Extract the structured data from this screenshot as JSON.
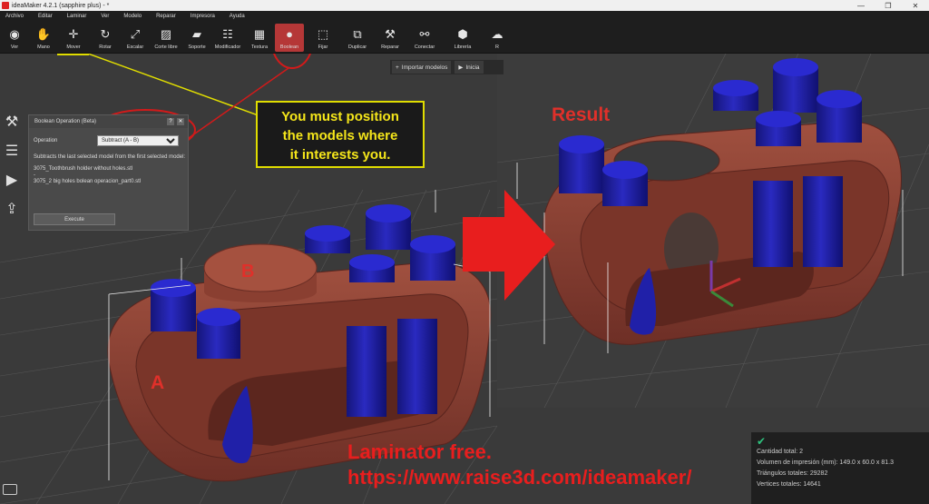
{
  "window": {
    "title": "ideaMaker 4.2.1 (sapphire plus) - *",
    "controls": [
      "—",
      "❐",
      "✕"
    ]
  },
  "menu": [
    "Archivo",
    "Editar",
    "Laminar",
    "Ver",
    "Modelo",
    "Reparar",
    "Impresora",
    "Ayuda"
  ],
  "toolbar": {
    "tools": [
      {
        "label": "Ver",
        "icon": "eye-icon",
        "glyph": "◉"
      },
      {
        "label": "Mano",
        "icon": "hand-icon",
        "glyph": "✋"
      },
      {
        "label": "Mover",
        "icon": "move-icon",
        "glyph": "✛"
      },
      {
        "label": "Rotar",
        "icon": "rotate-icon",
        "glyph": "↻"
      },
      {
        "label": "Escalar",
        "icon": "scale-icon",
        "glyph": "⤢"
      },
      {
        "label": "Corte libre",
        "icon": "cut-icon",
        "glyph": "▨"
      },
      {
        "label": "Soporte",
        "icon": "support-icon",
        "glyph": "▰"
      },
      {
        "label": "Modificador",
        "icon": "modifier-icon",
        "glyph": "☷"
      },
      {
        "label": "Textura",
        "icon": "texture-icon",
        "glyph": "▦"
      },
      {
        "label": "Boolean",
        "icon": "boolean-icon",
        "glyph": "●"
      },
      {
        "label": "Fijar",
        "icon": "pin-icon",
        "glyph": "⬚"
      },
      {
        "label": "Duplicar",
        "icon": "duplicate-icon",
        "glyph": "⧉"
      },
      {
        "label": "Reparar",
        "icon": "wrench-icon",
        "glyph": "⚒"
      },
      {
        "label": "Conectar",
        "icon": "connect-icon",
        "glyph": "⚯"
      },
      {
        "label": "Librería",
        "icon": "library-icon",
        "glyph": "⬢"
      },
      {
        "label": "R",
        "icon": "cloud-icon",
        "glyph": "☁"
      }
    ]
  },
  "side": {
    "icons": [
      {
        "name": "wrench-icon",
        "glyph": "⚒"
      },
      {
        "name": "list-icon",
        "glyph": "☰"
      },
      {
        "name": "play-icon",
        "glyph": "▶"
      },
      {
        "name": "export-icon",
        "glyph": "⇪"
      }
    ]
  },
  "dialog": {
    "title": "Boolean Operation (Beta)",
    "help": "?",
    "close": "✕",
    "operation_label": "Operation",
    "operation_value": "Subtract (A - B)",
    "description": "Subtracts the last selected model from the first selected model:",
    "model_a": "3075_Toothbrush holder without holes.stl",
    "separator": "-",
    "model_b": "3075_2 big  holes  bolean operacion_part0.stl",
    "execute": "Execute"
  },
  "import_bar": {
    "import_label": "Importar modelos",
    "start_label": "Inicia"
  },
  "annotations": {
    "callout": [
      "You must position",
      "the models where",
      "it interests you."
    ],
    "result": "Result",
    "label_a": "A",
    "label_b": "B",
    "footer_line1": "Laminator free.",
    "footer_line2": "https://www.raise3d.com/ideamaker/"
  },
  "info": {
    "count": "Cantidad total: 2",
    "volume": "Volumen de impresión (mm): 149.0 x 60.0 x 81.3",
    "triangles": "Triángulos totales: 29282",
    "vertices": "Vertices totales: 14641"
  },
  "colors": {
    "model_body": "#8c3f33",
    "cylinder": "#1f1fa0",
    "accent_red": "#e0302a",
    "callout_yellow": "#e0dd00"
  }
}
